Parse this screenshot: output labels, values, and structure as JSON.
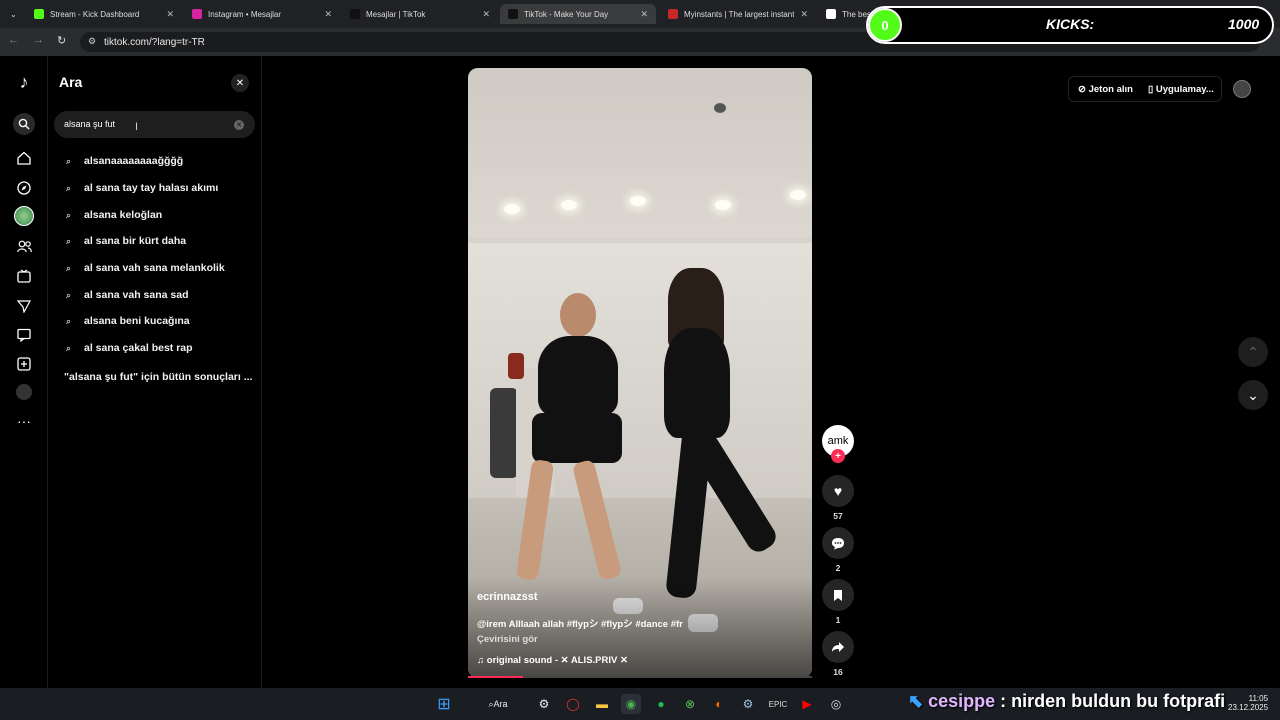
{
  "browser": {
    "tabs": [
      {
        "title": "Stream - Kick Dashboard",
        "favcolor": "#53fc18"
      },
      {
        "title": "Instagram • Mesajlar",
        "favcolor": "#d6249f"
      },
      {
        "title": "Mesajlar | TikTok",
        "favcolor": "#111111"
      },
      {
        "title": "TikTok - Make Your Day",
        "favcolor": "#111111"
      },
      {
        "title": "Myinstants | The largest instant",
        "favcolor": "#c62828"
      },
      {
        "title": "The best ... and Widgets",
        "favcolor": "#ffffff"
      }
    ],
    "url": "tiktok.com/?lang=tr-TR"
  },
  "kicks_overlay": {
    "ball_value": "0",
    "label": "KICKS:",
    "count": "1000"
  },
  "search_panel": {
    "title": "Ara",
    "query": "alsana şu fut",
    "suggestions": [
      "alsanaaaaaaaağğğğ",
      "al sana tay tay halası akımı",
      "alsana keloğlan",
      "al sana bir kürt daha",
      "al sana vah sana melankolik",
      "al sana vah sana sad",
      "alsana beni kucağına",
      "al sana çakal best rap"
    ],
    "all_results": "\"alsana şu fut\" için bütün sonuçları ..."
  },
  "header": {
    "coins": "Jeton alın",
    "app": "Uygulamay..."
  },
  "video": {
    "username": "ecrinnazsst",
    "description": "@irem Alllaah allah #flypシ #flypシ #dance #fr",
    "translate": "Çevirisini gör",
    "sound": "original sound - ✕ ALIS.PRIV ✕",
    "progress": 0.16
  },
  "actions": {
    "creator_avatar": "amk",
    "likes": "57",
    "comments": "2",
    "saves": "1",
    "shares": "16"
  },
  "taskbar": {
    "search": "Ara",
    "time": "11:05",
    "date": "23.12.2025"
  },
  "chat_overlay": {
    "user": "cesippe",
    "message": ": nirden buldun bu fotprafi"
  }
}
